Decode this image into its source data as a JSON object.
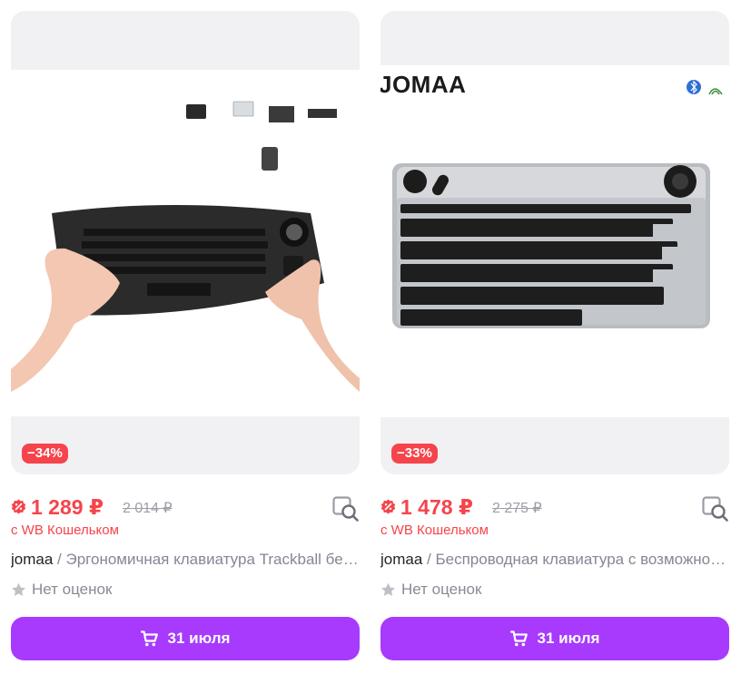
{
  "products": [
    {
      "image_alt": "Беспроводная клавиатура с трекболом в руках",
      "discount_badge": "−34%",
      "price": "1 289 ₽",
      "old_price": "2 014 ₽",
      "wallet_note": "с WB Кошельком",
      "brand": "jomaa",
      "separator": " / ",
      "title": "Эргономичная клавиатура Trackball беспроводная",
      "rating_text": "Нет оценок",
      "cart_button": "31 июля"
    },
    {
      "image_alt": "Беспроводная клавиатура JOMAA с трекболом",
      "image_brand_logo": "JOMAA",
      "discount_badge": "−33%",
      "price": "1 478 ₽",
      "old_price": "2 275 ₽",
      "wallet_note": "с WB Кошельком",
      "brand": "jomaa",
      "separator": " / ",
      "title": "Беспроводная клавиатура с возможностью подключения",
      "rating_text": "Нет оценок",
      "cart_button": "31 июля"
    }
  ],
  "colors": {
    "accent_price": "#f5444b",
    "cart_button": "#a73afd",
    "image_bg": "#f1f0f3"
  },
  "icons": {
    "price_badge": "wb-wallet-discount-icon",
    "compare": "similar-search-icon",
    "rating": "star-icon",
    "cart": "cart-icon"
  }
}
